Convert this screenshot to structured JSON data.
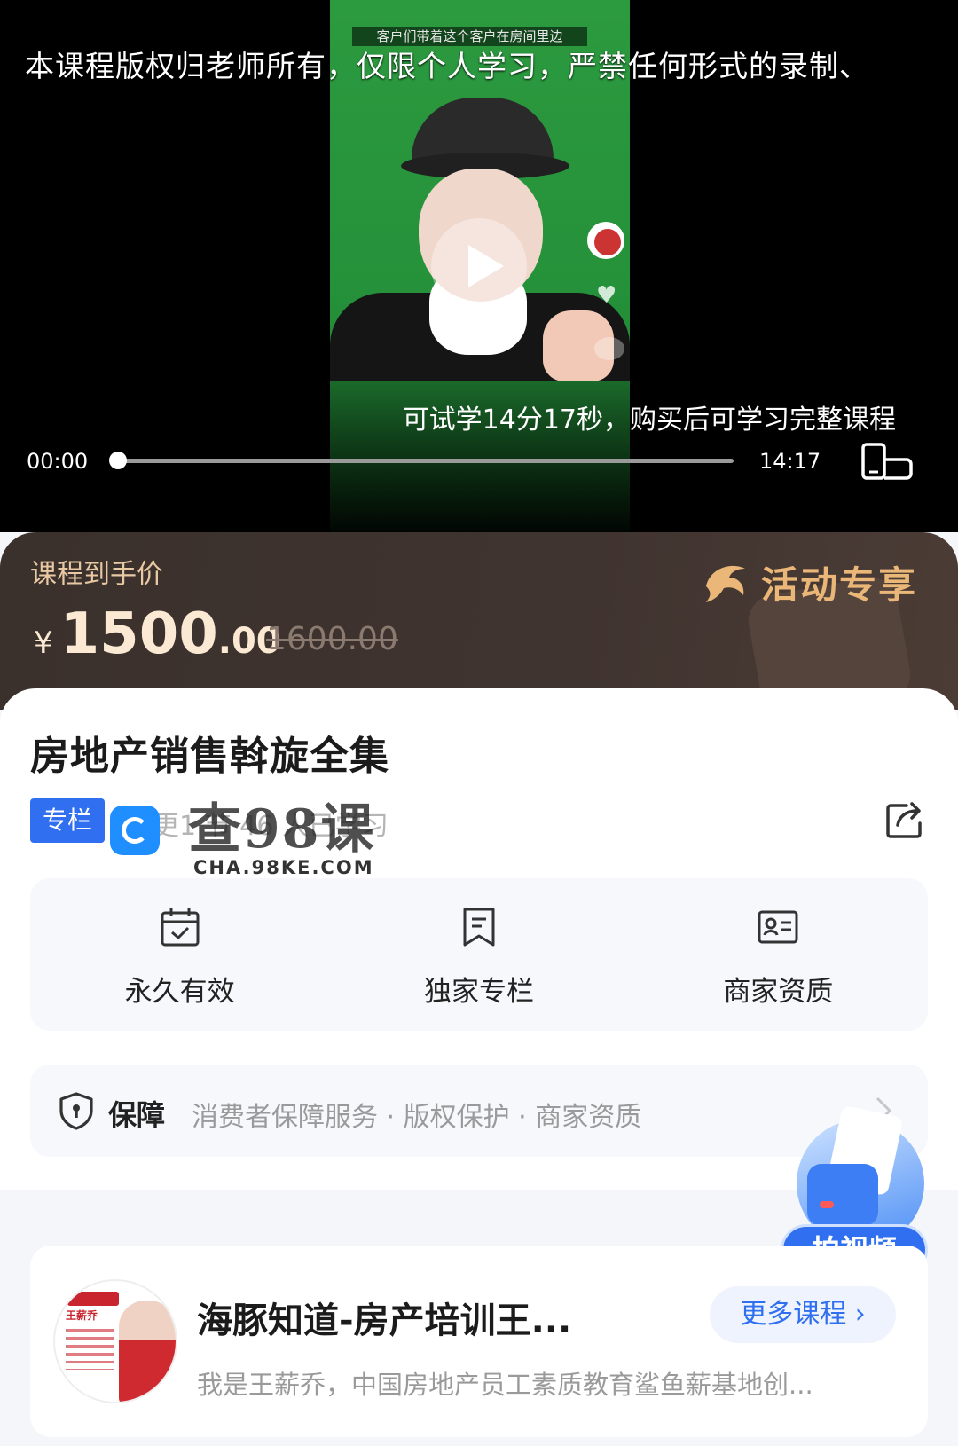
{
  "player": {
    "copyright": "本课程版权归老师所有，仅限个人学习，严禁任何形式的录制、",
    "video_top_caption": "客户们带着这个客户在房间里边",
    "trial_notice": "可试学14分17秒，购买后可学习完整课程",
    "time_current": "00:00",
    "time_total": "14:17",
    "progress_fraction": 0
  },
  "price": {
    "label": "课程到手价",
    "currency": "¥",
    "integer": "1500",
    "decimal": ".00",
    "original": "1600.00",
    "activity": "活动专享"
  },
  "course": {
    "title": "房地产销售斡旋全集",
    "badge": "专栏",
    "meta": "更1  节  46  人已学习",
    "watermark": "查98课",
    "watermark_domain": "CHA.98KE.COM"
  },
  "features": [
    {
      "label": "永久有效",
      "icon": "calendar-check-icon"
    },
    {
      "label": "独家专栏",
      "icon": "bookmark-icon"
    },
    {
      "label": "商家资质",
      "icon": "id-card-icon"
    }
  ],
  "guarantee": {
    "title": "保障",
    "text": "消费者保障服务 · 版权保护 · 商家资质"
  },
  "float_button": {
    "label": "拍视频"
  },
  "teacher": {
    "name": "海豚知道-房产培训王...",
    "more": "更多课程",
    "desc": "我是王薪乔，中国房地产员工素质教育鲨鱼薪基地创...",
    "avatar_brand": "王薪乔"
  },
  "colors": {
    "accent": "#2f6ff0",
    "price_gold": "#ebb778",
    "banner_bg": "#3a302c"
  }
}
